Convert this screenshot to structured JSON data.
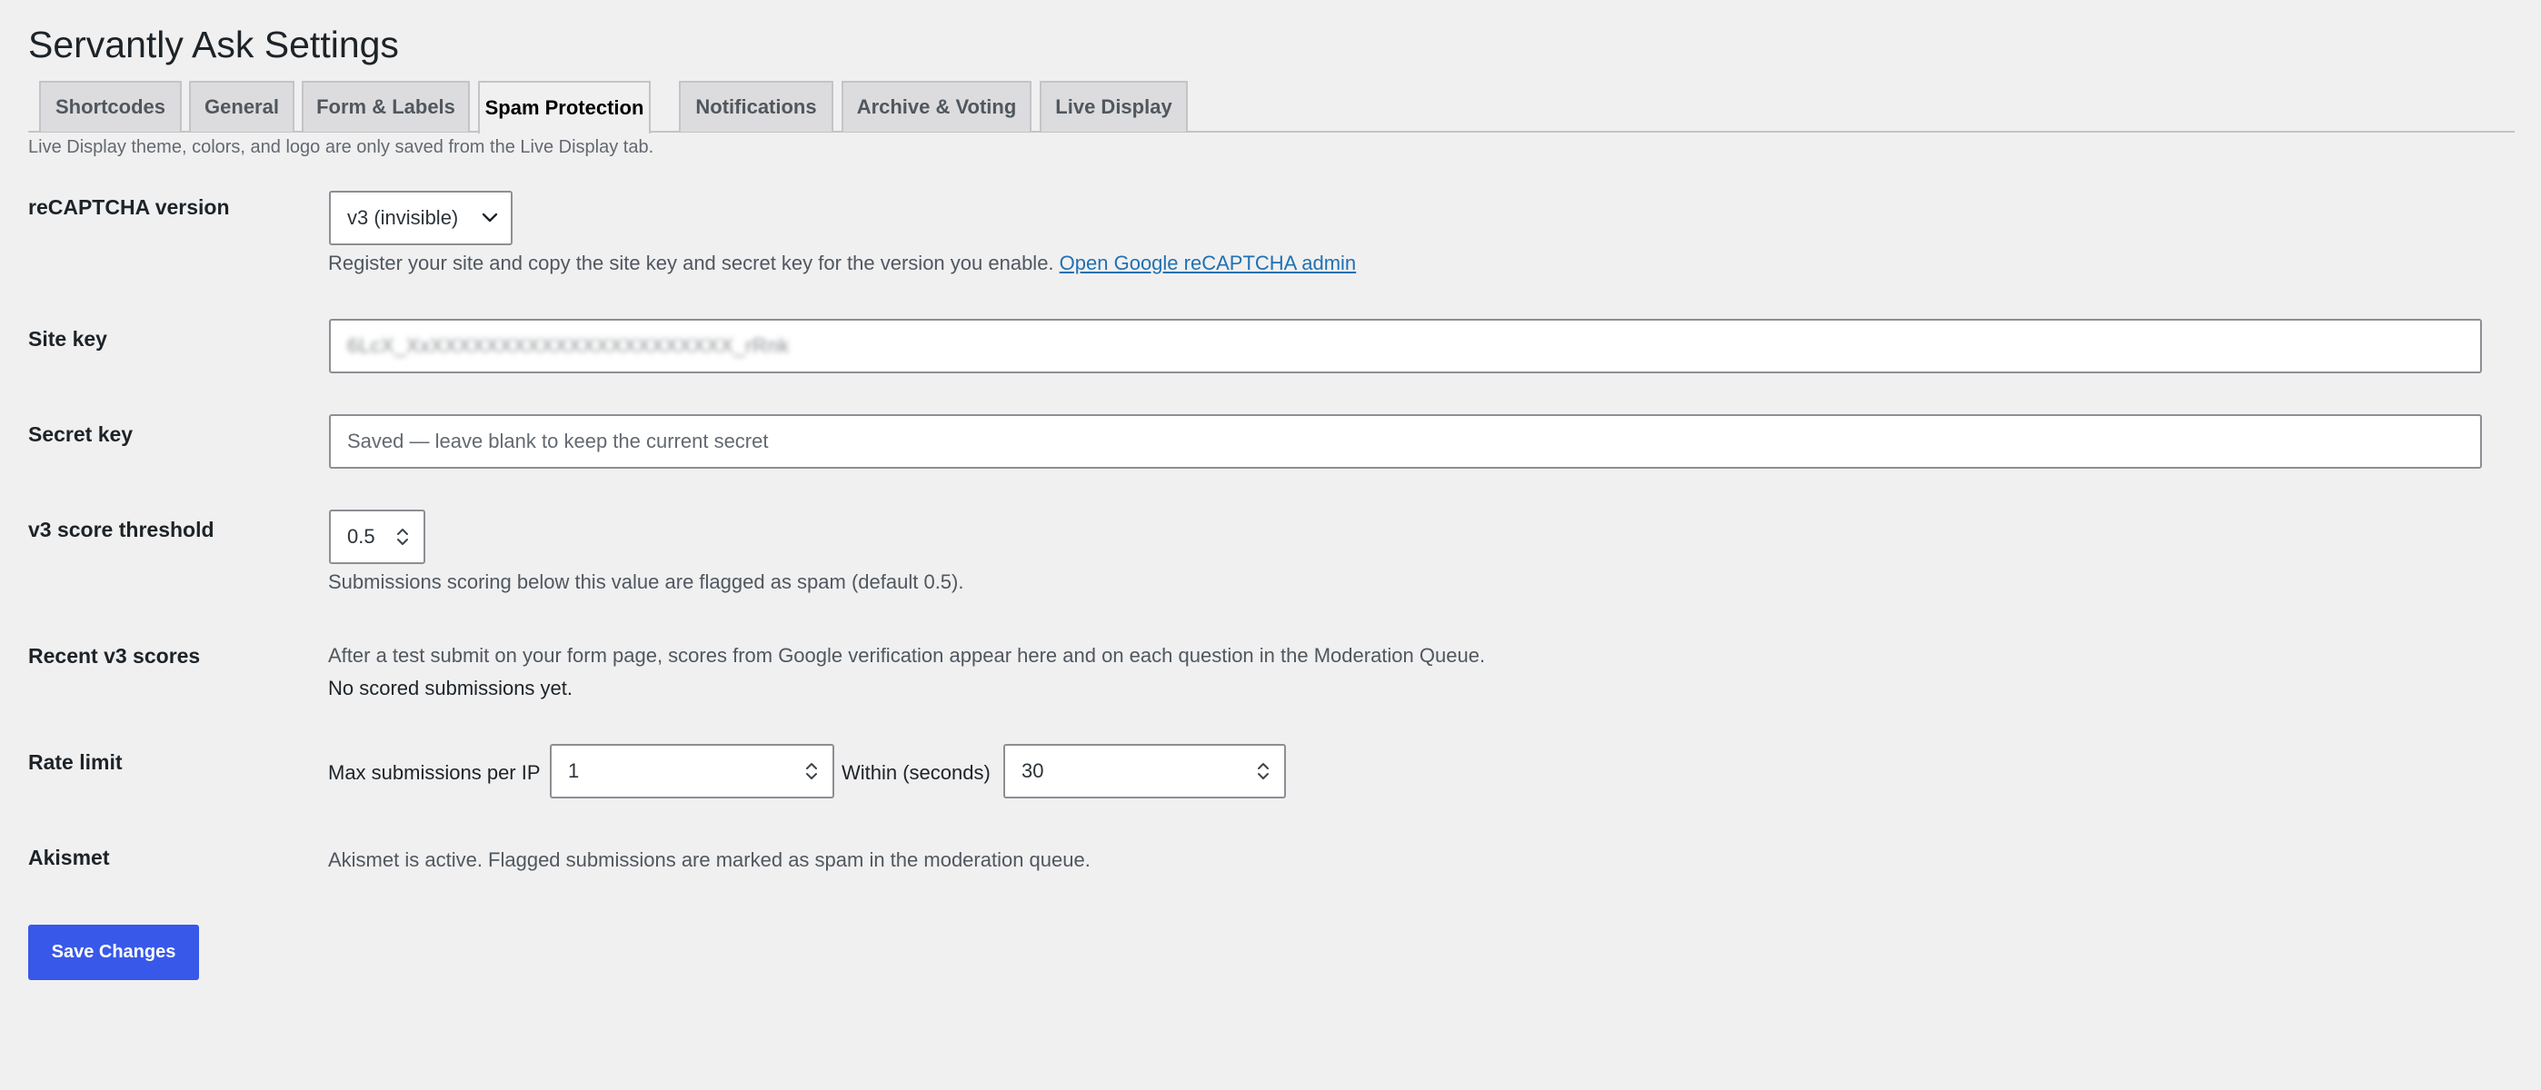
{
  "page": {
    "title": "Servantly Ask Settings"
  },
  "tabs": [
    {
      "label": "Shortcodes"
    },
    {
      "label": "General"
    },
    {
      "label": "Form & Labels"
    },
    {
      "label": "Spam Protection"
    },
    {
      "label": "Notifications"
    },
    {
      "label": "Archive & Voting"
    },
    {
      "label": "Live Display"
    }
  ],
  "active_tab": "Spam Protection",
  "notice": "Live Display theme, colors, and logo are only saved from the Live Display tab.",
  "recaptcha": {
    "label": "reCAPTCHA version",
    "selected": "v3 (invisible)",
    "help": "Register your site and copy the site key and secret key for the version you enable.",
    "link_text": "Open Google reCAPTCHA admin"
  },
  "site_key": {
    "label": "Site key",
    "value": "6LcX_XxXXXXXXXXXXXXXXXXXXXXXX_rRnk"
  },
  "secret_key": {
    "label": "Secret key",
    "placeholder": "Saved — leave blank to keep the current secret"
  },
  "threshold": {
    "label": "v3 score threshold",
    "value": "0.5",
    "help": "Submissions scoring below this value are flagged as spam (default 0.5)."
  },
  "recent_scores": {
    "label": "Recent v3 scores",
    "help": "After a test submit on your form page, scores from Google verification appear here and on each question in the Moderation Queue.",
    "empty": "No scored submissions yet."
  },
  "rate_limit": {
    "label": "Rate limit",
    "max_label": "Max submissions per IP",
    "max_value": "1",
    "within_label": "Within (seconds)",
    "within_value": "30"
  },
  "akismet": {
    "label": "Akismet",
    "status": "Akismet is active. Flagged submissions are marked as spam in the moderation queue."
  },
  "save_button": "Save Changes",
  "colors": {
    "accent": "#3858e9",
    "link": "#2271b1",
    "background": "#f0f0f1"
  }
}
